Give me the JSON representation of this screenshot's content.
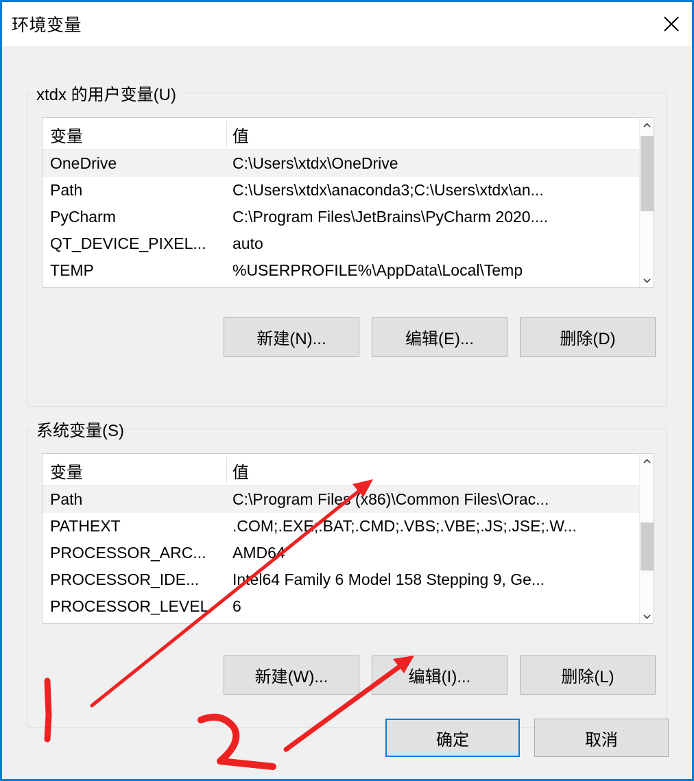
{
  "window": {
    "title": "环境变量",
    "close_icon": "close-icon",
    "accent_color": "#0a7cd2",
    "surface_color": "#f0f0f0"
  },
  "user_section": {
    "label": "xtdx 的用户变量(U)",
    "columns": [
      "变量",
      "值"
    ],
    "rows": [
      {
        "name": "OneDrive",
        "value": "C:\\Users\\xtdx\\OneDrive",
        "selected": true
      },
      {
        "name": "Path",
        "value": "C:\\Users\\xtdx\\anaconda3;C:\\Users\\xtdx\\an...",
        "selected": false
      },
      {
        "name": "PyCharm",
        "value": "C:\\Program Files\\JetBrains\\PyCharm 2020....",
        "selected": false
      },
      {
        "name": "QT_DEVICE_PIXEL...",
        "value": "auto",
        "selected": false
      },
      {
        "name": "TEMP",
        "value": "%USERPROFILE%\\AppData\\Local\\Temp",
        "selected": false
      }
    ],
    "buttons": {
      "new": "新建(N)...",
      "edit": "编辑(E)...",
      "delete": "删除(D)"
    }
  },
  "system_section": {
    "label": "系统变量(S)",
    "columns": [
      "变量",
      "值"
    ],
    "rows": [
      {
        "name": "Path",
        "value": "C:\\Program Files (x86)\\Common Files\\Orac...",
        "selected": true
      },
      {
        "name": "PATHEXT",
        "value": ".COM;.EXE;.BAT;.CMD;.VBS;.VBE;.JS;.JSE;.W...",
        "selected": false
      },
      {
        "name": "PROCESSOR_ARC...",
        "value": "AMD64",
        "selected": false
      },
      {
        "name": "PROCESSOR_IDE...",
        "value": "Intel64 Family 6 Model 158 Stepping 9, Ge...",
        "selected": false
      },
      {
        "name": "PROCESSOR_LEVEL",
        "value": "6",
        "selected": false
      }
    ],
    "buttons": {
      "new": "新建(W)...",
      "edit": "编辑(I)...",
      "delete": "删除(L)"
    }
  },
  "footer": {
    "ok": "确定",
    "cancel": "取消"
  },
  "annotations": {
    "color": "#ee2222",
    "marks": [
      "stroke-one",
      "stroke-two",
      "arrow-to-system-path-row",
      "arrow-to-system-edit-button"
    ]
  }
}
